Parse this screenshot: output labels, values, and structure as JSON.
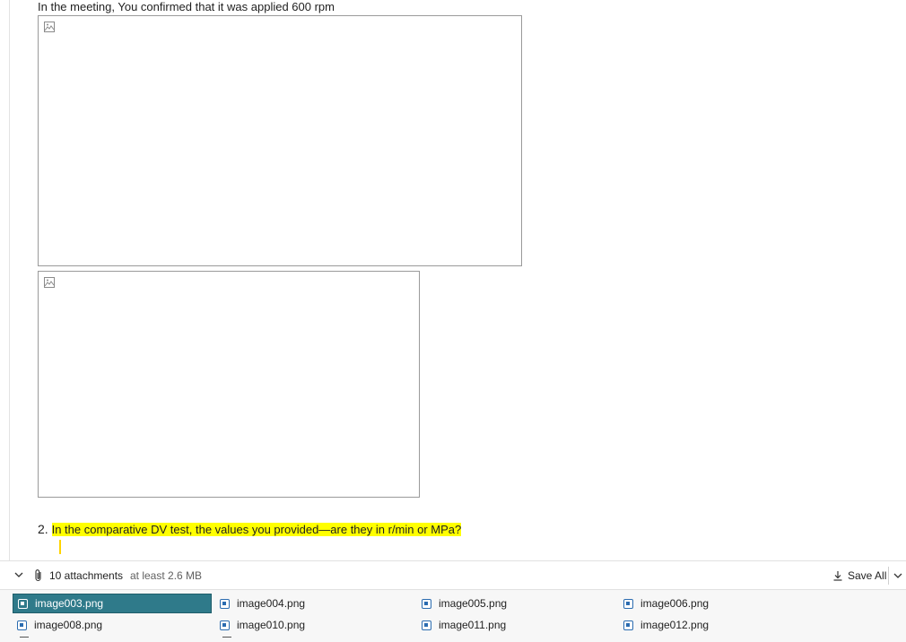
{
  "message": {
    "intro": "In the meeting, You confirmed that it was applied 600 rpm",
    "question_number": "2.",
    "question_text": "In the comparative DV test, the values you provided—are they in r/min or MPa?"
  },
  "attachments": {
    "count_label": "10 attachments",
    "size_label": "at least 2.6 MB",
    "save_all_label": "Save All",
    "files": [
      "image003.png",
      "image004.png",
      "image005.png",
      "image006.png",
      "image008.png",
      "image010.png",
      "image011.png",
      "image012.png"
    ],
    "selected": "image003.png"
  },
  "colors": {
    "highlight": "#ffff00",
    "selected_attachment": "#2f7a8a",
    "file_icon": "#2b6cb0"
  }
}
